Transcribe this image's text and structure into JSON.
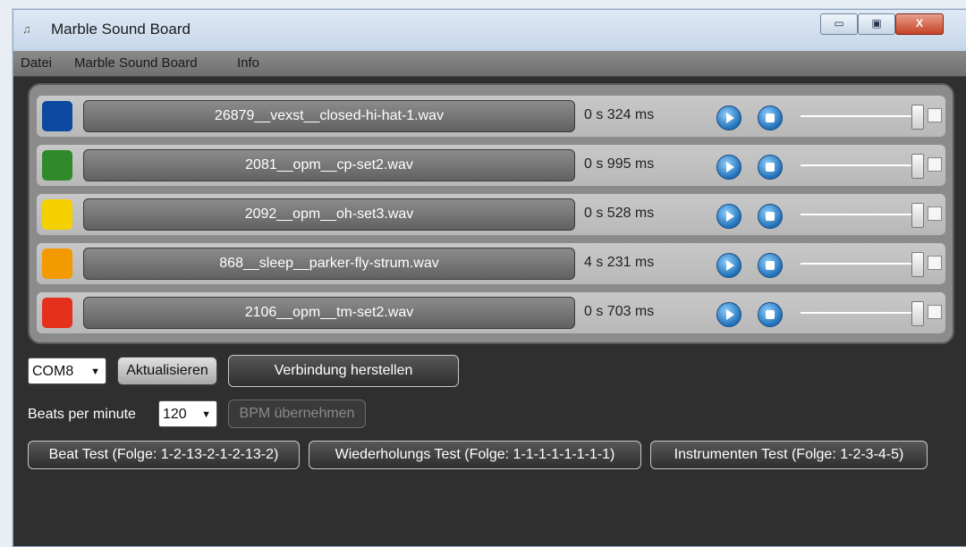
{
  "window": {
    "title": "Marble Sound Board",
    "close_glyph": "X",
    "min_glyph": "▭",
    "max_glyph": "▣"
  },
  "menu": [
    "Datei",
    "Marble Sound Board",
    "Info"
  ],
  "sounds": [
    {
      "color": "#0b4aa0",
      "file": "26879__vexst__closed-hi-hat-1.wav",
      "duration": "0 s 324 ms"
    },
    {
      "color": "#2f8a2b",
      "file": "2081__opm__cp-set2.wav",
      "duration": "0 s 995 ms"
    },
    {
      "color": "#f5d000",
      "file": "2092__opm__oh-set3.wav",
      "duration": "0 s 528 ms"
    },
    {
      "color": "#f29a00",
      "file": "868__sleep__parker-fly-strum.wav",
      "duration": "4 s 231 ms"
    },
    {
      "color": "#e5311b",
      "file": "2106__opm__tm-set2.wav",
      "duration": "0 s 703 ms"
    }
  ],
  "connection": {
    "port": "COM8",
    "refresh_label": "Aktualisieren",
    "connect_label": "Verbindung herstellen"
  },
  "bpm": {
    "label": "Beats per minute",
    "value": "120",
    "apply_label": "BPM übernehmen"
  },
  "tests": [
    "Beat Test (Folge: 1-2-13-2-1-2-13-2)",
    "Wiederholungs Test (Folge: 1-1-1-1-1-1-1-1)",
    "Instrumenten Test (Folge: 1-2-3-4-5)"
  ]
}
